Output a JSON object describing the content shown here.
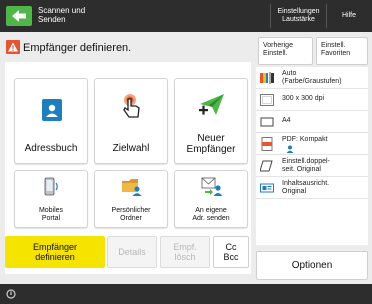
{
  "topbar": {
    "title_line1": "Scannen und",
    "title_line2": "Senden",
    "settings_line1": "Einstellungen",
    "settings_line2": "Lautstärke",
    "help_label": "Hilfe"
  },
  "header": {
    "title": "Empfänger definieren."
  },
  "top_right": {
    "prev_line1": "Vorherige",
    "prev_line2": "Einstell.",
    "fav_line1": "Einstell.",
    "fav_line2": "Favoriten"
  },
  "tiles": {
    "address_book": "Adressbuch",
    "one_touch": "Zielwahl",
    "new_dest_line1": "Neuer",
    "new_dest_line2": "Empfänger",
    "mobile_line1": "Mobiles",
    "mobile_line2": "Portal",
    "personal_line1": "Persönlicher",
    "personal_line2": "Ordner",
    "send_myself_line1": "An eigene",
    "send_myself_line2": "Adr. senden"
  },
  "bottom_buttons": {
    "specify_line1": "Empfänger",
    "specify_line2": "definieren",
    "details": "Details",
    "delete_line1": "Empf.",
    "delete_line2": "lösch",
    "cc_line1": "Cc",
    "cc_line2": "Bcc"
  },
  "settings": {
    "color_line1": "Auto",
    "color_line2": "(Farbe/Graustufen)",
    "resolution": "300 x 300 dpi",
    "size": "A4",
    "format_line1": "PDF: Kompakt",
    "duplex_line1": "Einstell.doppel-",
    "duplex_line2": "seit. Original",
    "orientation_line1": "Inhaltsausricht.",
    "orientation_line2": "Original"
  },
  "options_label": "Optionen",
  "colors": {
    "accent_green": "#4db848",
    "accent_yellow": "#f5e400",
    "icon_blue": "#1e7fc0",
    "warn_red": "#e8542f"
  }
}
